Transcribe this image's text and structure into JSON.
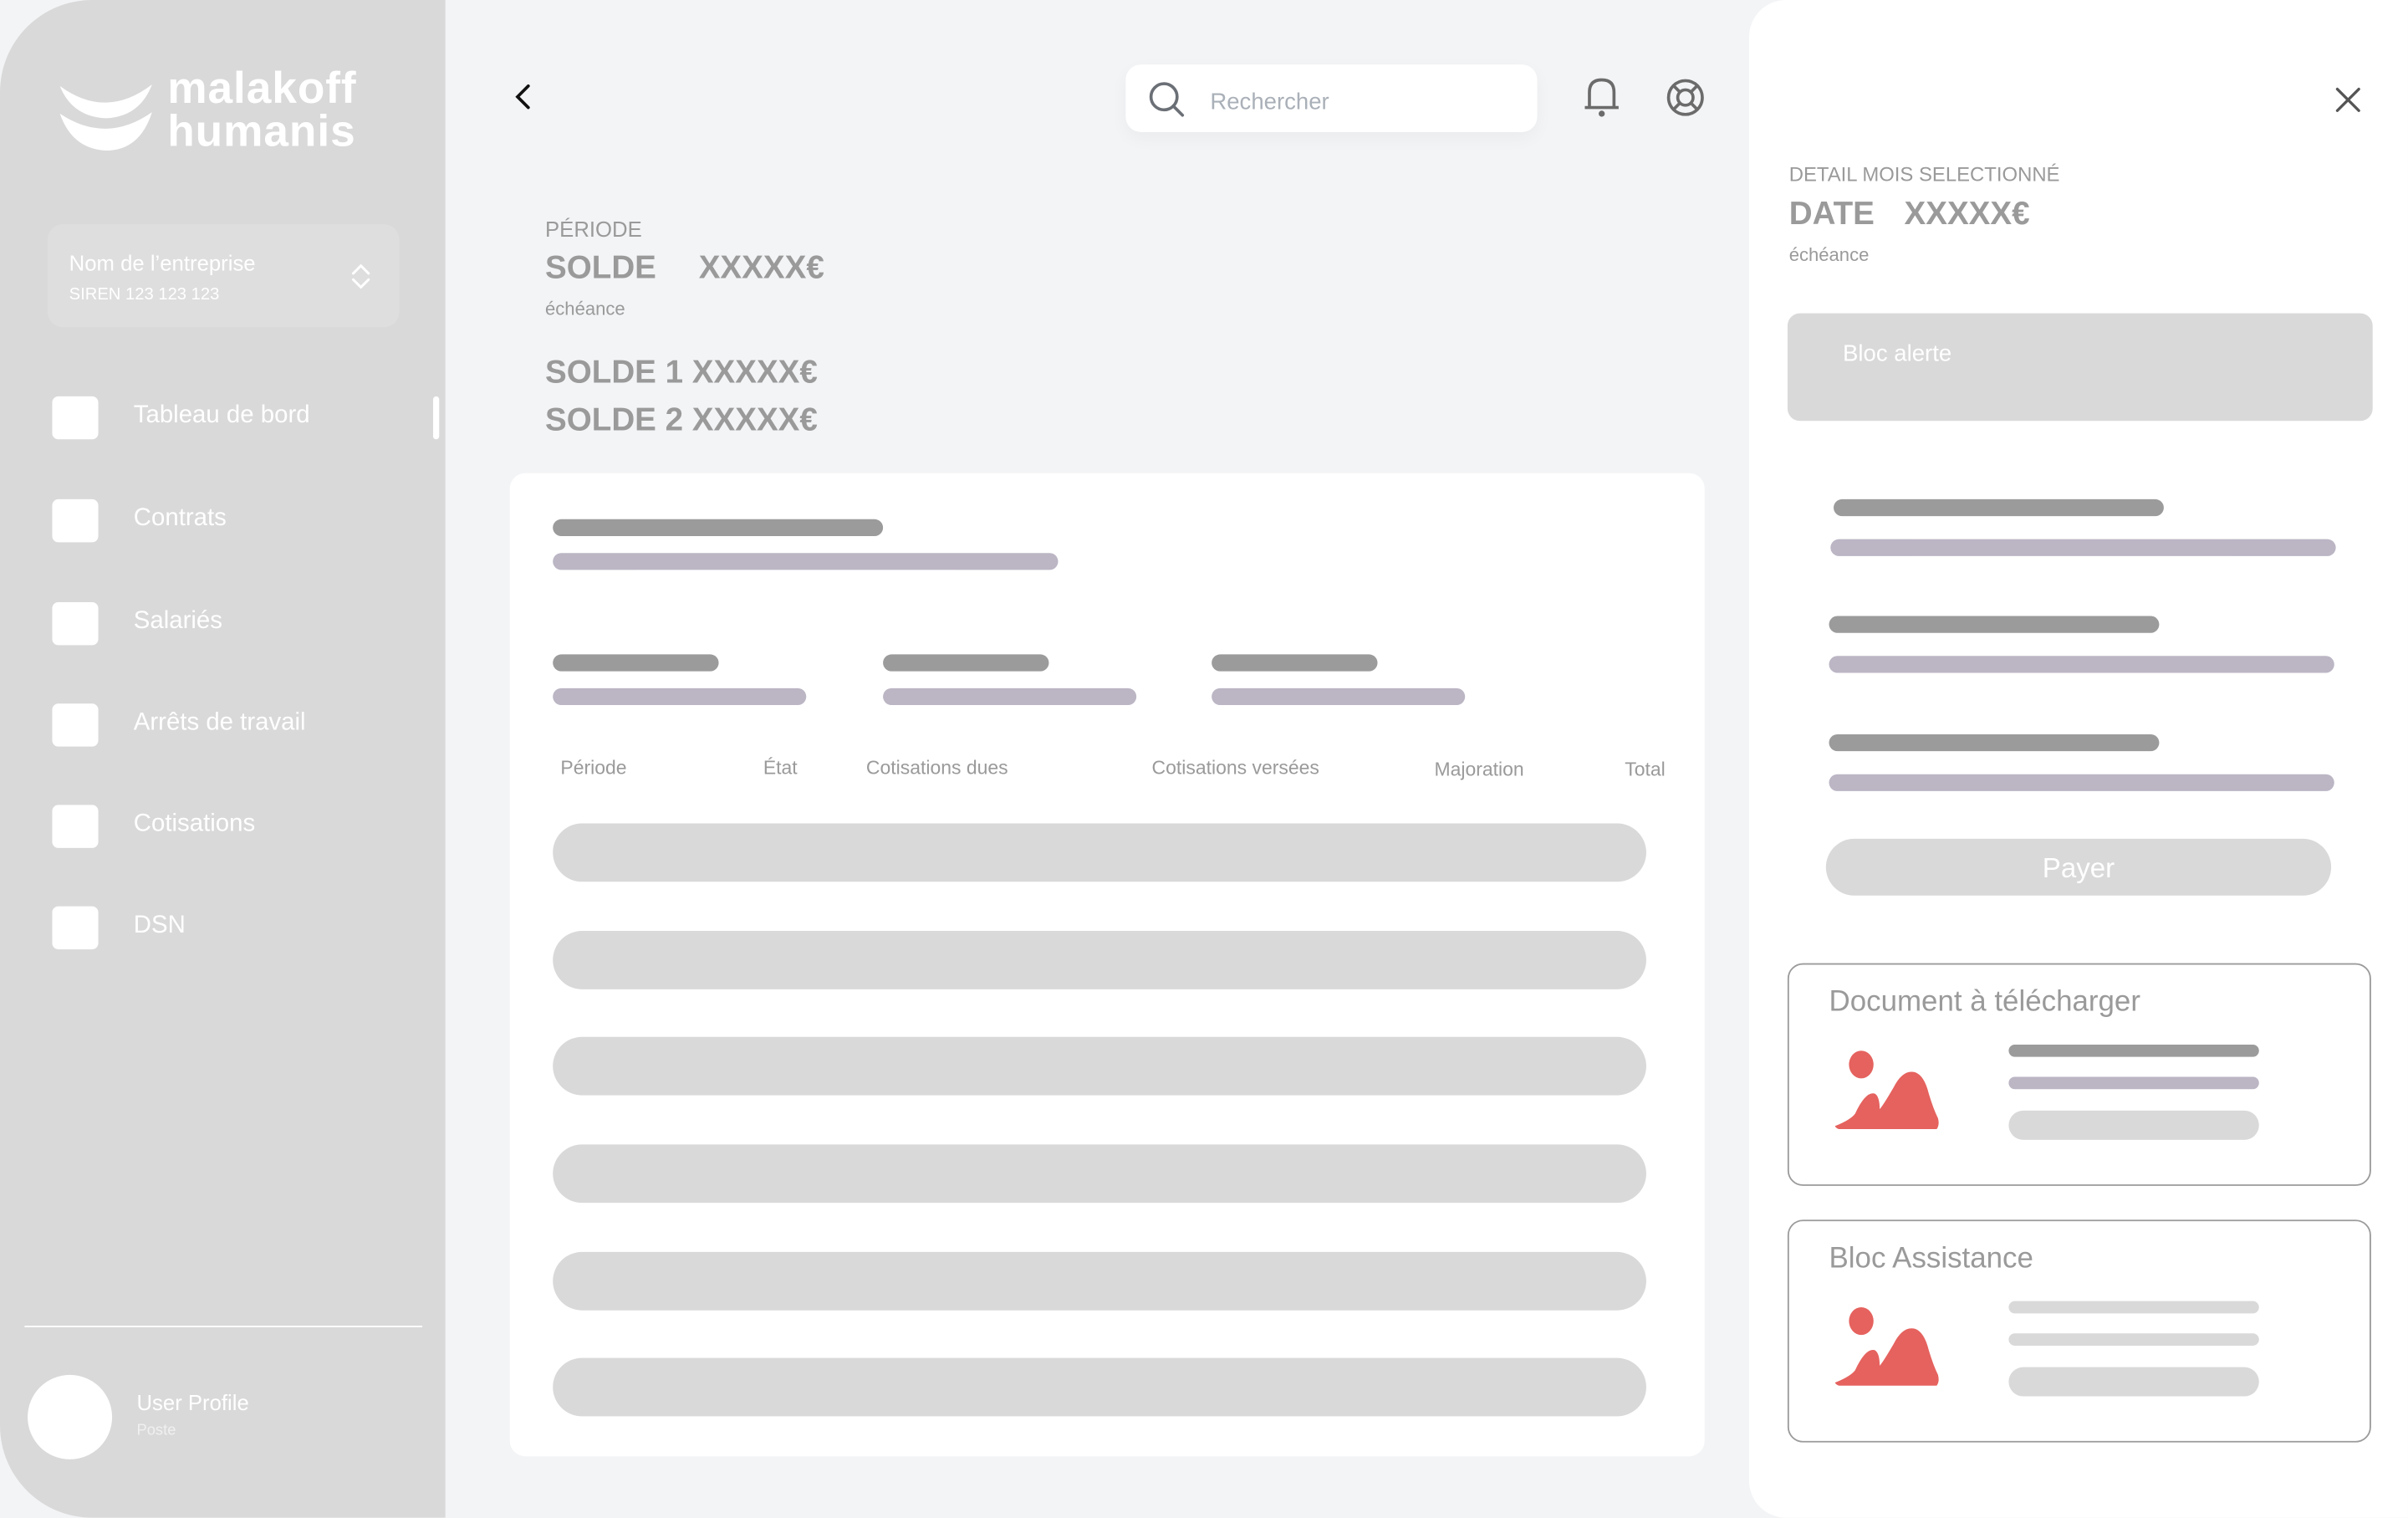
{
  "brand": {
    "logo_text_line1": "malakoff",
    "logo_text_line2": "humanis"
  },
  "company_selector": {
    "name": "Nom de l’entreprise",
    "siren": "SIREN 123 123 123",
    "icon": "chevron-up-down-icon"
  },
  "sidebar": {
    "items": [
      {
        "label": "Tableau de bord",
        "active": true
      },
      {
        "label": "Contrats"
      },
      {
        "label": "Salariés"
      },
      {
        "label": "Arrêts de travail"
      },
      {
        "label": "Cotisations"
      },
      {
        "label": "DSN"
      }
    ]
  },
  "user": {
    "name": "User Profile",
    "role": "Poste"
  },
  "header": {
    "search_placeholder": "Rechercher",
    "icons": [
      "back-chevron-icon",
      "search-icon",
      "bell-icon",
      "help-lifebuoy-icon"
    ]
  },
  "summary": {
    "periode": "PÉRIODE",
    "solde_label": "SOLDE",
    "solde_value": "XXXXX€",
    "echeance": "échéance",
    "solde1": "SOLDE 1 XXXXX€",
    "solde2": "SOLDE 2 XXXXX€"
  },
  "table": {
    "columns": [
      "Période",
      "État",
      "Cotisations dues",
      "Cotisations versées",
      "Majoration",
      "Total"
    ],
    "row_count": 6
  },
  "detail": {
    "heading": "DETAIL MOIS SELECTIONNÉ",
    "date_label": "DATE",
    "amount": "XXXXX€",
    "echeance": "échéance",
    "alert": "Bloc alerte",
    "pay_button": "Payer",
    "document_title": "Document à télécharger",
    "assistance_title": "Bloc Assistance"
  },
  "colors": {
    "sidebar": "#d9d9d9",
    "background": "#f3f4f6",
    "placeholder_dark": "#9b9b9b",
    "placeholder_purple": "#bbb5c4",
    "illustration": "#e5625e"
  }
}
